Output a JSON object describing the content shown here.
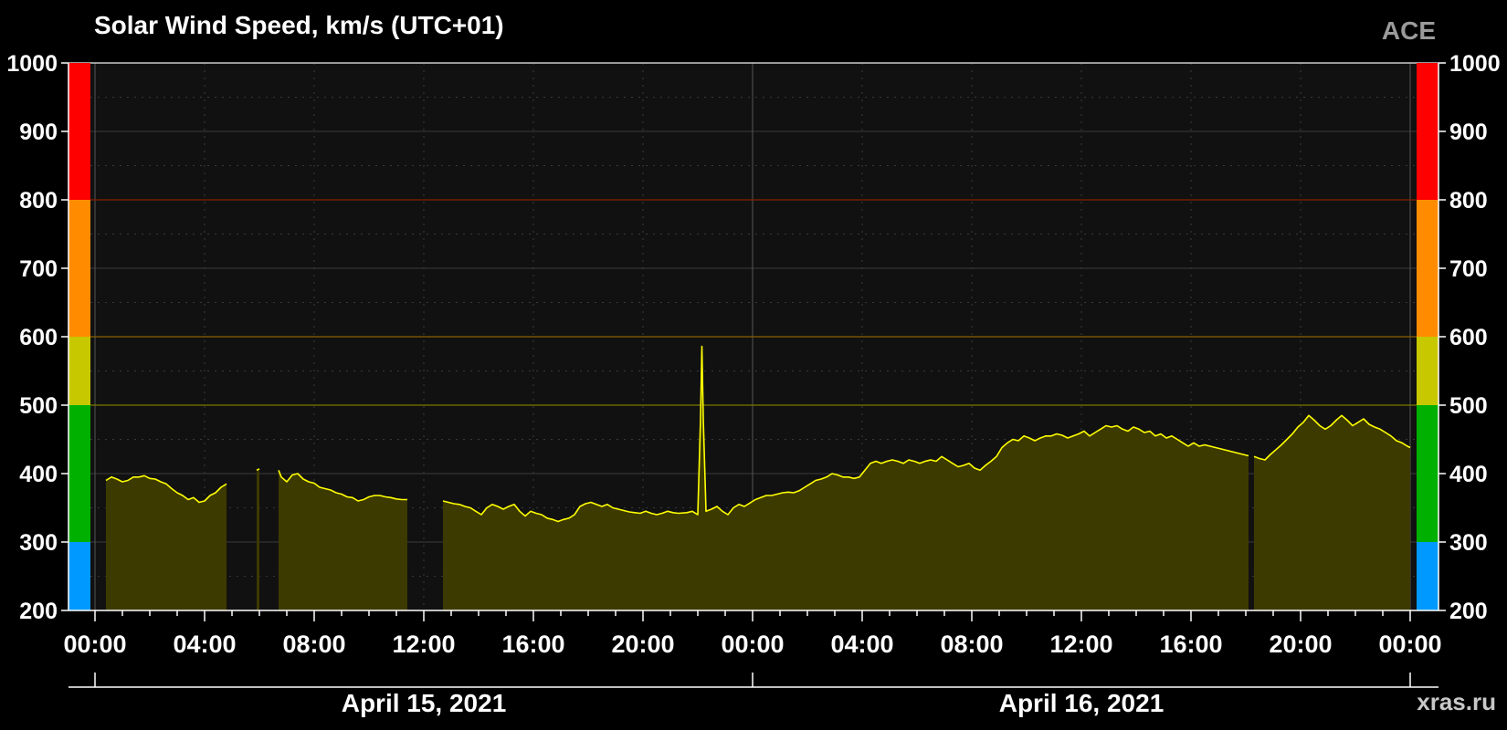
{
  "chart_data": {
    "type": "area",
    "title": "Solar Wind Speed, km/s (UTC+01)",
    "source_label": "ACE",
    "credit": "xras.ru",
    "ylim": [
      200,
      1000
    ],
    "yticks": [
      200,
      300,
      400,
      500,
      600,
      700,
      800,
      900,
      1000
    ],
    "yticks_text": [
      "200",
      "300",
      "400",
      "500",
      "600",
      "700",
      "800",
      "900",
      "1000"
    ],
    "x_range_hours": [
      0,
      48
    ],
    "xtick_labels": [
      "00:00",
      "04:00",
      "08:00",
      "12:00",
      "16:00",
      "20:00",
      "00:00",
      "04:00",
      "08:00",
      "12:00",
      "16:00",
      "20:00",
      "00:00"
    ],
    "date_labels": [
      {
        "label": "April 15, 2021",
        "center_hour": 12
      },
      {
        "label": "April 16, 2021",
        "center_hour": 36
      }
    ],
    "color_bands": [
      {
        "from": 200,
        "to": 300,
        "color": "#0099ff"
      },
      {
        "from": 300,
        "to": 500,
        "color": "#00b000"
      },
      {
        "from": 500,
        "to": 600,
        "color": "#c8c800"
      },
      {
        "from": 600,
        "to": 800,
        "color": "#ff8c00"
      },
      {
        "from": 800,
        "to": 1000,
        "color": "#ff0000"
      }
    ],
    "threshold_lines": [
      {
        "value": 500,
        "color": "#7a7a00"
      },
      {
        "value": 600,
        "color": "#8a6000"
      },
      {
        "value": 800,
        "color": "#8a2000"
      }
    ],
    "series": [
      {
        "color": "#ffff00",
        "fill": "#3d3a00",
        "segments": [
          [
            [
              0.4,
              390
            ],
            [
              0.6,
              395
            ],
            [
              0.8,
              392
            ],
            [
              1.0,
              388
            ],
            [
              1.2,
              390
            ],
            [
              1.4,
              395
            ],
            [
              1.6,
              395
            ],
            [
              1.8,
              397
            ],
            [
              2.0,
              393
            ],
            [
              2.2,
              392
            ],
            [
              2.4,
              388
            ],
            [
              2.6,
              385
            ],
            [
              2.8,
              378
            ],
            [
              3.0,
              372
            ],
            [
              3.2,
              368
            ],
            [
              3.4,
              362
            ],
            [
              3.6,
              365
            ],
            [
              3.8,
              358
            ],
            [
              4.0,
              360
            ],
            [
              4.2,
              368
            ],
            [
              4.4,
              372
            ],
            [
              4.6,
              380
            ],
            [
              4.8,
              385
            ]
          ],
          [
            [
              5.9,
              405
            ],
            [
              6.0,
              407
            ]
          ],
          [
            [
              6.7,
              405
            ],
            [
              6.8,
              395
            ],
            [
              7.0,
              388
            ],
            [
              7.2,
              398
            ],
            [
              7.4,
              400
            ],
            [
              7.6,
              392
            ],
            [
              7.8,
              388
            ],
            [
              8.0,
              386
            ],
            [
              8.2,
              380
            ],
            [
              8.4,
              378
            ],
            [
              8.6,
              376
            ],
            [
              8.8,
              372
            ],
            [
              9.0,
              370
            ],
            [
              9.2,
              366
            ],
            [
              9.4,
              365
            ],
            [
              9.6,
              360
            ],
            [
              9.8,
              362
            ],
            [
              10.0,
              366
            ],
            [
              10.2,
              368
            ],
            [
              10.4,
              368
            ],
            [
              10.6,
              366
            ],
            [
              10.8,
              365
            ],
            [
              11.0,
              363
            ],
            [
              11.2,
              362
            ],
            [
              11.4,
              362
            ]
          ],
          [
            [
              12.7,
              360
            ],
            [
              12.9,
              358
            ],
            [
              13.1,
              356
            ],
            [
              13.3,
              355
            ],
            [
              13.5,
              352
            ],
            [
              13.7,
              350
            ],
            [
              13.9,
              345
            ],
            [
              14.1,
              340
            ],
            [
              14.3,
              350
            ],
            [
              14.5,
              355
            ],
            [
              14.7,
              352
            ],
            [
              14.9,
              348
            ],
            [
              15.1,
              352
            ],
            [
              15.3,
              355
            ],
            [
              15.5,
              345
            ],
            [
              15.7,
              338
            ],
            [
              15.9,
              345
            ],
            [
              16.1,
              342
            ],
            [
              16.3,
              340
            ],
            [
              16.5,
              335
            ],
            [
              16.7,
              333
            ],
            [
              16.9,
              330
            ],
            [
              17.1,
              333
            ],
            [
              17.3,
              335
            ],
            [
              17.5,
              340
            ],
            [
              17.7,
              352
            ],
            [
              17.9,
              356
            ],
            [
              18.1,
              358
            ],
            [
              18.3,
              355
            ],
            [
              18.5,
              352
            ],
            [
              18.7,
              355
            ],
            [
              18.9,
              350
            ],
            [
              19.1,
              348
            ],
            [
              19.3,
              346
            ],
            [
              19.5,
              344
            ],
            [
              19.7,
              343
            ],
            [
              19.9,
              342
            ],
            [
              20.1,
              345
            ],
            [
              20.3,
              342
            ],
            [
              20.5,
              340
            ],
            [
              20.7,
              342
            ],
            [
              20.9,
              345
            ],
            [
              21.1,
              343
            ],
            [
              21.3,
              342
            ],
            [
              21.6,
              343
            ],
            [
              21.8,
              345
            ],
            [
              22.0,
              340
            ],
            [
              22.1,
              480
            ],
            [
              22.15,
              586
            ],
            [
              22.2,
              480
            ],
            [
              22.3,
              345
            ],
            [
              22.5,
              348
            ],
            [
              22.7,
              352
            ],
            [
              22.9,
              345
            ],
            [
              23.1,
              340
            ],
            [
              23.3,
              350
            ],
            [
              23.5,
              355
            ],
            [
              23.7,
              352
            ],
            [
              23.9,
              357
            ],
            [
              24.1,
              362
            ],
            [
              24.3,
              365
            ],
            [
              24.5,
              368
            ],
            [
              24.7,
              368
            ],
            [
              24.9,
              370
            ],
            [
              25.1,
              372
            ],
            [
              25.3,
              373
            ],
            [
              25.5,
              372
            ],
            [
              25.7,
              375
            ],
            [
              25.9,
              380
            ],
            [
              26.1,
              385
            ],
            [
              26.3,
              390
            ],
            [
              26.5,
              392
            ],
            [
              26.7,
              395
            ],
            [
              26.9,
              400
            ],
            [
              27.1,
              398
            ],
            [
              27.3,
              395
            ],
            [
              27.5,
              395
            ],
            [
              27.7,
              393
            ],
            [
              27.9,
              395
            ],
            [
              28.1,
              405
            ],
            [
              28.3,
              415
            ],
            [
              28.5,
              418
            ],
            [
              28.7,
              415
            ],
            [
              28.9,
              418
            ],
            [
              29.1,
              420
            ],
            [
              29.3,
              418
            ],
            [
              29.5,
              415
            ],
            [
              29.7,
              420
            ],
            [
              29.9,
              418
            ],
            [
              30.1,
              415
            ],
            [
              30.3,
              418
            ],
            [
              30.5,
              420
            ],
            [
              30.7,
              418
            ],
            [
              30.9,
              425
            ],
            [
              31.1,
              420
            ],
            [
              31.3,
              415
            ],
            [
              31.5,
              410
            ],
            [
              31.7,
              412
            ],
            [
              31.9,
              415
            ],
            [
              32.1,
              408
            ],
            [
              32.3,
              405
            ],
            [
              32.5,
              412
            ],
            [
              32.7,
              418
            ],
            [
              32.9,
              425
            ],
            [
              33.1,
              438
            ],
            [
              33.3,
              445
            ],
            [
              33.5,
              450
            ],
            [
              33.7,
              448
            ],
            [
              33.9,
              455
            ],
            [
              34.1,
              452
            ],
            [
              34.3,
              448
            ],
            [
              34.5,
              452
            ],
            [
              34.7,
              455
            ],
            [
              34.9,
              455
            ],
            [
              35.1,
              458
            ],
            [
              35.3,
              456
            ],
            [
              35.5,
              452
            ],
            [
              35.7,
              455
            ],
            [
              35.9,
              458
            ],
            [
              36.1,
              462
            ],
            [
              36.3,
              455
            ],
            [
              36.5,
              460
            ],
            [
              36.7,
              465
            ],
            [
              36.9,
              470
            ],
            [
              37.1,
              468
            ],
            [
              37.3,
              470
            ],
            [
              37.5,
              465
            ],
            [
              37.7,
              462
            ],
            [
              37.9,
              468
            ],
            [
              38.1,
              465
            ],
            [
              38.3,
              460
            ],
            [
              38.5,
              462
            ],
            [
              38.7,
              455
            ],
            [
              38.9,
              458
            ],
            [
              39.1,
              452
            ],
            [
              39.3,
              455
            ],
            [
              39.5,
              450
            ],
            [
              39.7,
              445
            ],
            [
              39.9,
              440
            ],
            [
              40.1,
              445
            ],
            [
              40.3,
              440
            ],
            [
              40.5,
              442
            ],
            [
              40.7,
              440
            ],
            [
              40.9,
              438
            ],
            [
              41.1,
              436
            ],
            [
              41.3,
              434
            ],
            [
              41.5,
              432
            ],
            [
              41.7,
              430
            ],
            [
              41.9,
              428
            ],
            [
              42.1,
              426
            ]
          ],
          [
            [
              42.3,
              425
            ],
            [
              42.5,
              422
            ],
            [
              42.7,
              420
            ],
            [
              42.9,
              428
            ],
            [
              43.1,
              435
            ],
            [
              43.3,
              442
            ],
            [
              43.5,
              450
            ],
            [
              43.7,
              458
            ],
            [
              43.9,
              468
            ],
            [
              44.1,
              475
            ],
            [
              44.3,
              485
            ],
            [
              44.5,
              478
            ],
            [
              44.7,
              470
            ],
            [
              44.9,
              465
            ],
            [
              45.1,
              470
            ],
            [
              45.3,
              478
            ],
            [
              45.5,
              485
            ],
            [
              45.7,
              478
            ],
            [
              45.9,
              470
            ],
            [
              46.1,
              475
            ],
            [
              46.3,
              480
            ],
            [
              46.5,
              472
            ],
            [
              46.7,
              468
            ],
            [
              46.9,
              465
            ],
            [
              47.1,
              460
            ],
            [
              47.3,
              455
            ],
            [
              47.5,
              448
            ],
            [
              47.7,
              445
            ],
            [
              47.9,
              440
            ],
            [
              48.0,
              438
            ]
          ]
        ]
      }
    ]
  }
}
